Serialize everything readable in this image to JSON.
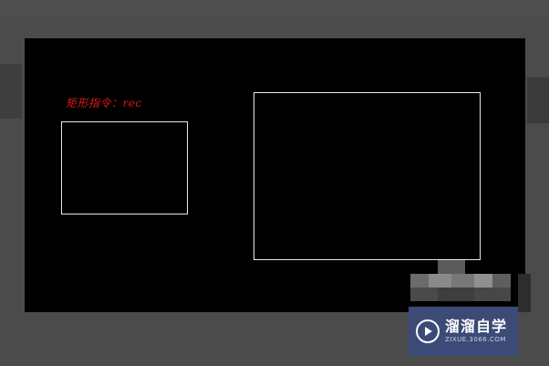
{
  "command_text": "矩形指令：rec",
  "watermark": {
    "name": "溜溜自学",
    "url": "ZIXUE.3066.COM"
  },
  "colors": {
    "canvas": "#000000",
    "command_text": "#e01818",
    "rectangle_stroke": "#e8e8e8",
    "watermark_bg": "#3c4a78"
  },
  "icons": [
    "play-logo-icon"
  ]
}
